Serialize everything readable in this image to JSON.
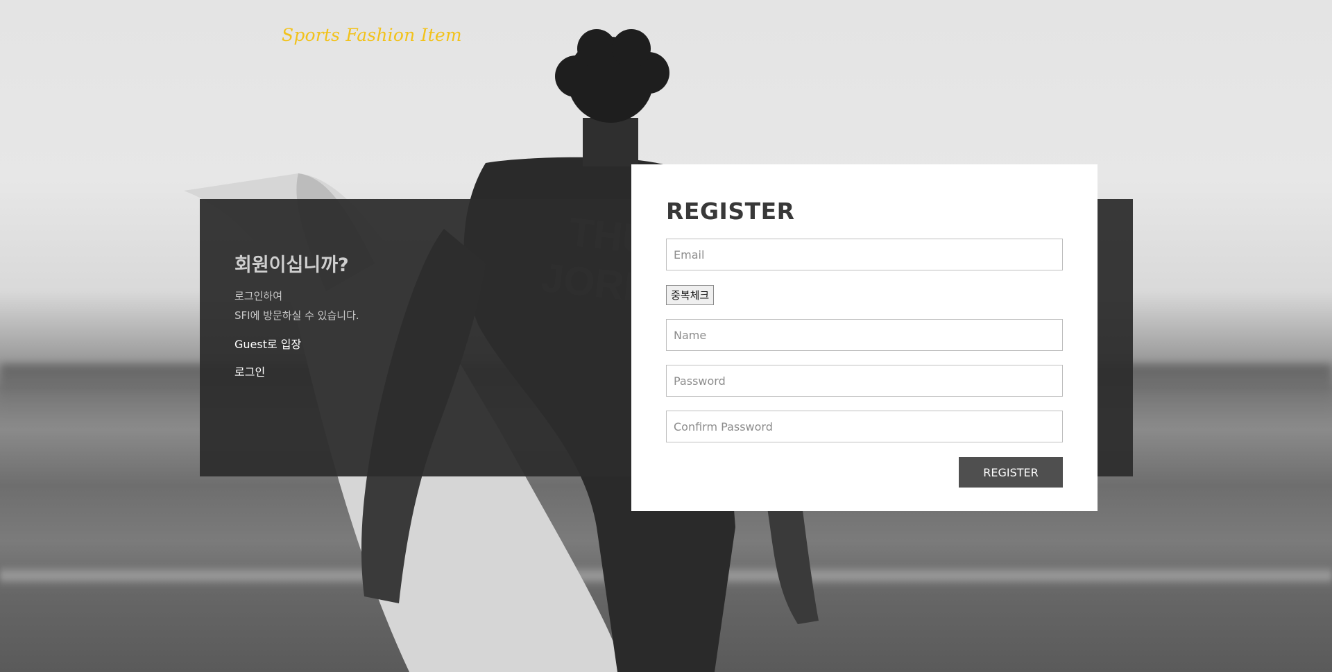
{
  "brand": {
    "logo_text": "Sports Fashion Item",
    "logo_color": "#f2c21a"
  },
  "login_panel": {
    "heading": "회원이십니까?",
    "desc_line1": "로그인하여",
    "desc_line2": "SFI에 방문하실 수 있습니다.",
    "guest_link": "Guest로 입장",
    "login_link": "로그인"
  },
  "register": {
    "title": "REGISTER",
    "email_placeholder": "Email",
    "duplicate_check_label": "중복체크",
    "name_placeholder": "Name",
    "password_placeholder": "Password",
    "confirm_password_placeholder": "Confirm Password",
    "submit_label": "REGISTER",
    "submit_color": "#4f4f4f"
  },
  "background": {
    "icon": "surfer-photo"
  }
}
